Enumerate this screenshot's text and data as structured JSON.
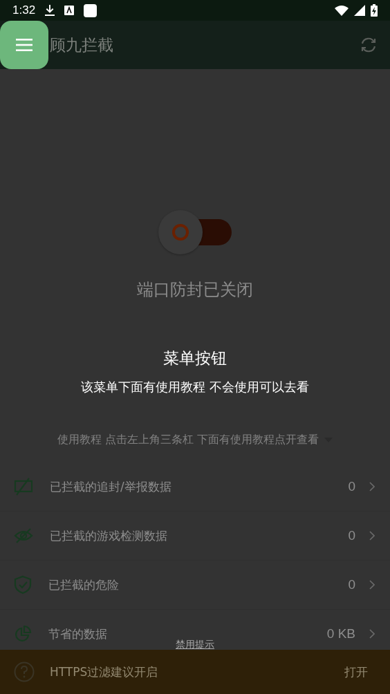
{
  "status_bar": {
    "time": "1:32"
  },
  "app_bar": {
    "title": "顾九拦截"
  },
  "protection": {
    "on": false,
    "label": "端口防封已关闭"
  },
  "tutorial": {
    "title": "菜单按钮",
    "text": "该菜单下面有使用教程 不会使用可以去看"
  },
  "hint": {
    "text": "使用教程 点击左上角三条杠 下面有使用教程点开查看"
  },
  "stats": [
    {
      "kind": "tracking",
      "label": "已拦截的追封/举报数据",
      "value": "0"
    },
    {
      "kind": "detection",
      "label": "已拦截的游戏检测数据",
      "value": "0"
    },
    {
      "kind": "danger",
      "label": "已拦截的危险",
      "value": "0"
    },
    {
      "kind": "data",
      "label": "节省的数据",
      "value": "0 KB"
    }
  ],
  "dismiss_link": "禁用提示",
  "banner": {
    "text": "HTTPS过滤建议开启",
    "action": "打开"
  }
}
